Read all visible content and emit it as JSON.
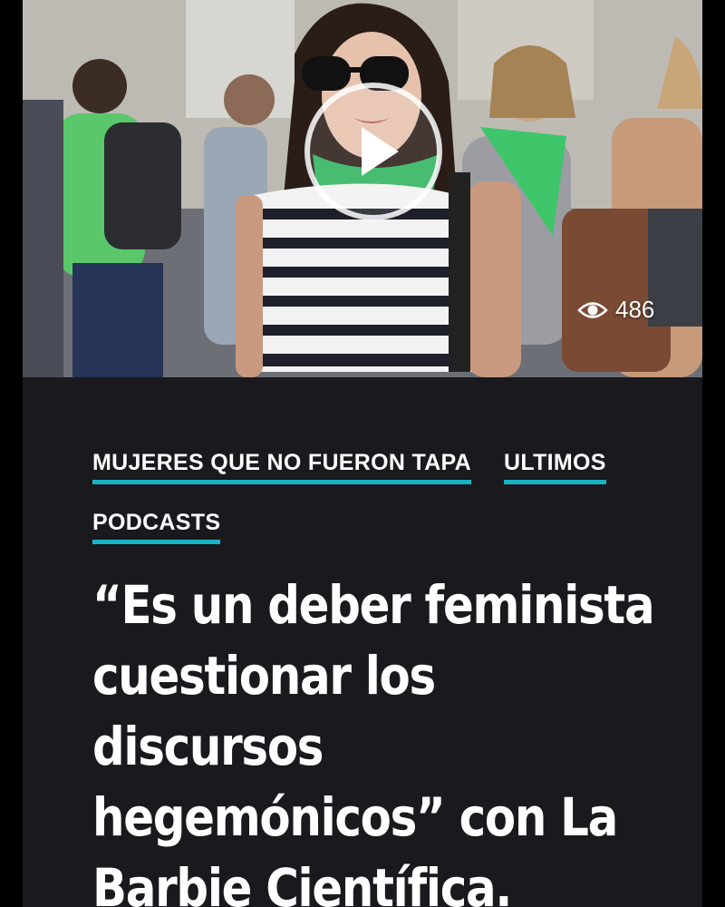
{
  "post": {
    "video": {
      "play_label": "Play video",
      "views": "486"
    },
    "tags": [
      "MUJERES QUE NO FUERON TAPA",
      "ULTIMOS",
      "PODCASTS"
    ],
    "headline": "“Es un deber feminista cuestionar los discursos hegemónicos” con La Barbie Científica."
  },
  "colors": {
    "background": "#19191e",
    "accent": "#18b4c4",
    "text": "#ffffff"
  },
  "icons": {
    "play": "play-icon",
    "views": "eye-icon"
  }
}
